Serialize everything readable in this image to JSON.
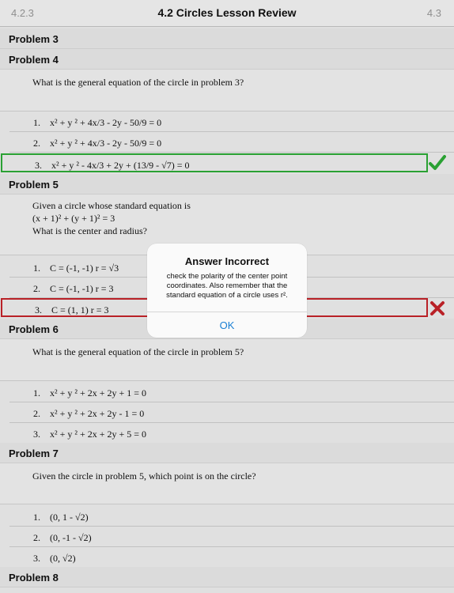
{
  "nav": {
    "back": "4.2.3",
    "title": "4.2  Circles Lesson Review",
    "forward": "4.3"
  },
  "problems": {
    "p3": {
      "header": "Problem 3"
    },
    "p4": {
      "header": "Problem 4",
      "question": "What is the general equation of the circle in problem 3?",
      "a1": {
        "num": "1.",
        "text": "x² + y ² + 4x/3 - 2y - 50/9 = 0"
      },
      "a2": {
        "num": "2.",
        "text": "x² + y ² + 4x/3 - 2y - 50/9 = 0"
      },
      "a3": {
        "num": "3.",
        "text": "x² + y ² - 4x/3 + 2y + (13/9 - √7) = 0"
      }
    },
    "p5": {
      "header": "Problem 5",
      "q1": "Given a circle whose standard equation is",
      "q2": "(x + 1)² + (y + 1)² = 3",
      "q3": "What is the center and radius?",
      "a1": {
        "num": "1.",
        "text": "C = (-1, -1) r = √3"
      },
      "a2": {
        "num": "2.",
        "text": "C = (-1, -1) r = 3"
      },
      "a3": {
        "num": "3.",
        "text": "C = (1, 1) r = 3"
      }
    },
    "p6": {
      "header": "Problem 6",
      "question": "What is the general equation of the circle in problem 5?",
      "a1": {
        "num": "1.",
        "text": "x² + y ² + 2x + 2y + 1 = 0"
      },
      "a2": {
        "num": "2.",
        "text": "x² + y ² + 2x + 2y - 1 = 0"
      },
      "a3": {
        "num": "3.",
        "text": "x² + y ² + 2x + 2y + 5 = 0"
      }
    },
    "p7": {
      "header": "Problem 7",
      "question": "Given the circle in problem 5, which point is on the circle?",
      "a1": {
        "num": "1.",
        "text": "(0, 1 - √2)"
      },
      "a2": {
        "num": "2.",
        "text": "(0, -1 - √2)"
      },
      "a3": {
        "num": "3.",
        "text": "(0, √2)"
      }
    },
    "p8": {
      "header": "Problem 8"
    }
  },
  "alert": {
    "title": "Answer Incorrect",
    "message": "check the polarity of the center point coordinates. Also remember that the standard equation of a circle uses r².",
    "ok": "OK"
  },
  "colors": {
    "correct": "#2eae37",
    "incorrect": "#c8242b",
    "link": "#1a7fd4"
  },
  "icons": {
    "correct": "checkmark-icon",
    "incorrect": "x-mark-icon"
  }
}
